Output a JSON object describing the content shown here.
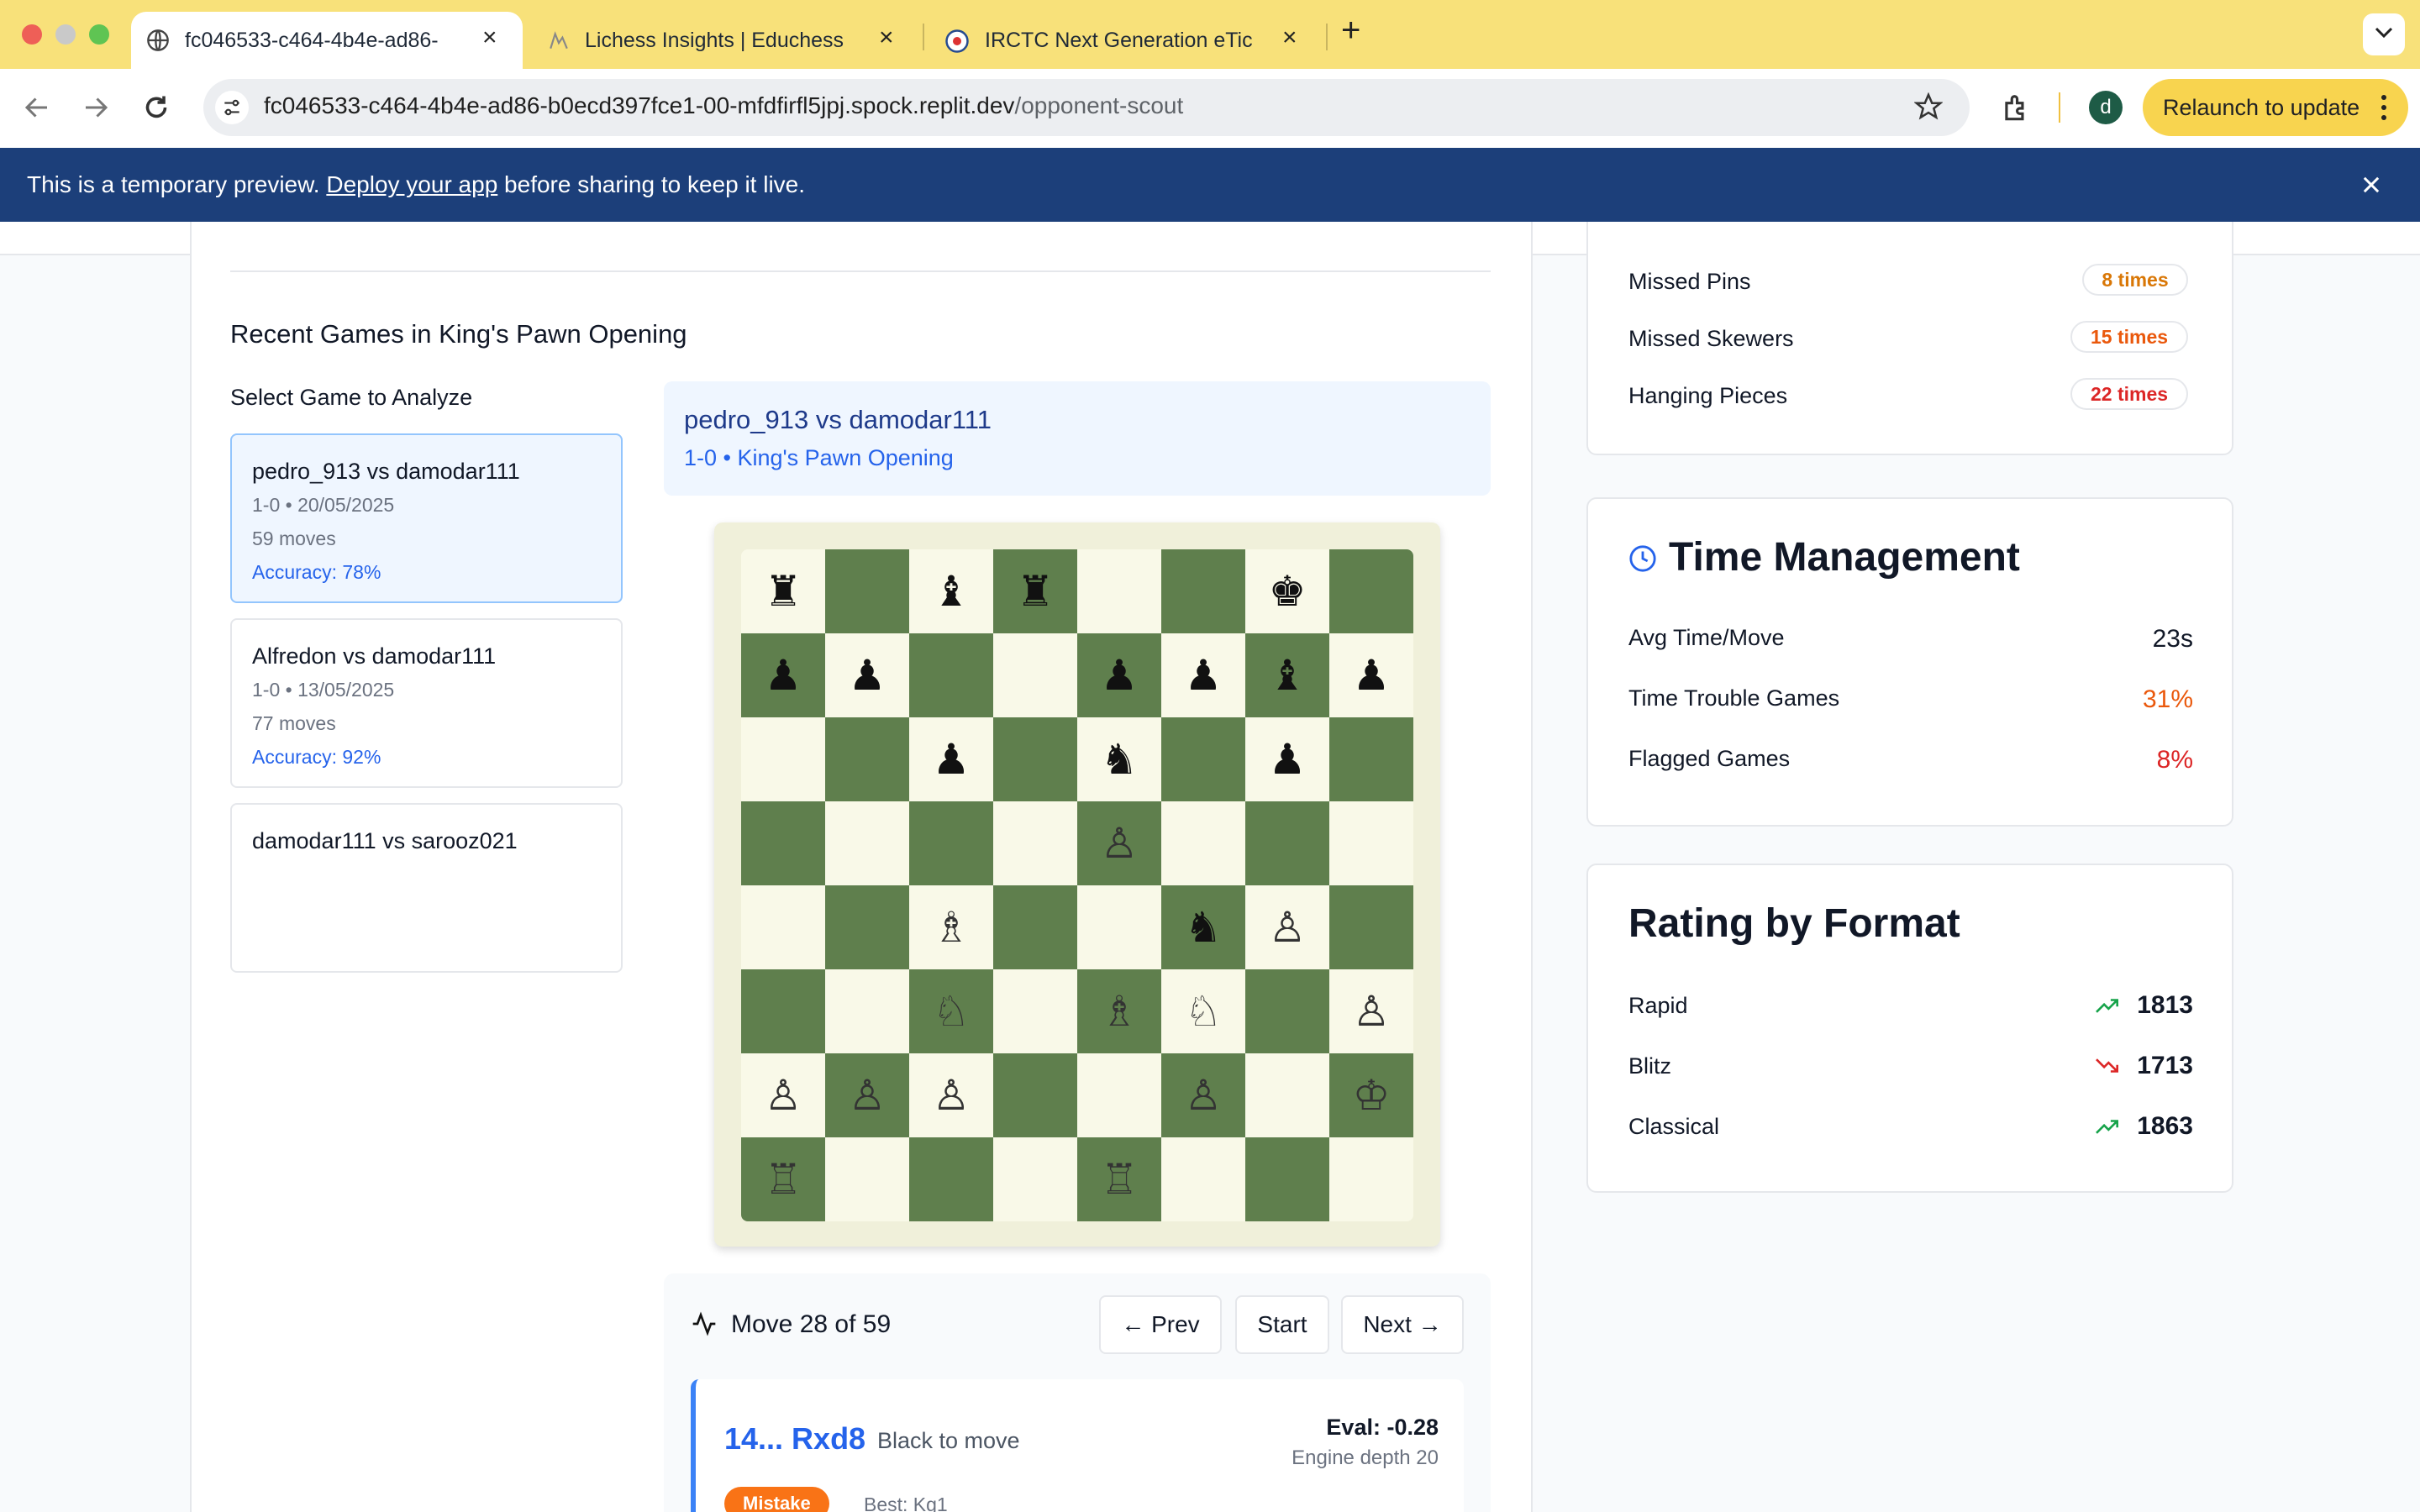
{
  "browser": {
    "tabs": [
      {
        "title": "fc046533-c464-4b4e-ad86-",
        "active": true
      },
      {
        "title": "Lichess Insights | Educhess",
        "active": false
      },
      {
        "title": "IRCTC Next Generation eTicke",
        "active": false
      }
    ],
    "url_host": "fc046533-c464-4b4e-ad86-b0ecd397fce1-00-mfdfirfl5jpj.spock.replit.dev",
    "url_path": "/opponent-scout",
    "profile_initial": "d",
    "relaunch_label": "Relaunch to update"
  },
  "banner": {
    "prefix": "This is a temporary preview.",
    "link": "Deploy your app",
    "suffix": "before sharing to keep it live."
  },
  "recent": {
    "heading": "Recent Games in King's Pawn Opening",
    "select_label": "Select Game to Analyze",
    "games": [
      {
        "title": "pedro_913 vs damodar111",
        "meta": "1-0 • 20/05/2025",
        "moves": "59 moves",
        "accuracy": "Accuracy: 78%"
      },
      {
        "title": "Alfredon vs damodar111",
        "meta": "1-0 • 13/05/2025",
        "moves": "77 moves",
        "accuracy": "Accuracy: 92%"
      },
      {
        "title": "damodar111 vs sarooz021"
      }
    ]
  },
  "selected_game": {
    "title": "pedro_913 vs damodar111",
    "subtitle": "1-0 • King's Pawn Opening"
  },
  "board": [
    [
      "r",
      "",
      "b",
      "r",
      "",
      "",
      "k",
      ""
    ],
    [
      "p",
      "p",
      "",
      "",
      "p",
      "p",
      "b",
      "p"
    ],
    [
      "",
      "",
      "p",
      "",
      "n",
      "",
      "p",
      ""
    ],
    [
      "",
      "",
      "",
      "",
      "P",
      "",
      "",
      ""
    ],
    [
      "",
      "",
      "B",
      "",
      "",
      "n",
      "P",
      ""
    ],
    [
      "",
      "",
      "N",
      "",
      "B",
      "N",
      "",
      "P"
    ],
    [
      "P",
      "P",
      "P",
      "",
      "",
      "P",
      "",
      "K"
    ],
    [
      "R",
      "",
      "",
      "",
      "R",
      "",
      "",
      ""
    ]
  ],
  "move_nav": {
    "label": "Move 28 of 59",
    "prev": "← Prev",
    "start": "Start",
    "next": "Next →"
  },
  "move_detail": {
    "move": "14... Rxd8",
    "side": "Black to move",
    "eval": "Eval: -0.28",
    "depth": "Engine depth 20",
    "tag": "Mistake",
    "best": "Best: Kg1"
  },
  "tactics": [
    {
      "label": "Missed Pins",
      "count": "8 times",
      "color": "#d97706"
    },
    {
      "label": "Missed Skewers",
      "count": "15 times",
      "color": "#ea580c"
    },
    {
      "label": "Hanging Pieces",
      "count": "22 times",
      "color": "#dc2626"
    }
  ],
  "time_management": {
    "title": "Time Management",
    "rows": [
      {
        "label": "Avg Time/Move",
        "value": "23s",
        "color": "#111827"
      },
      {
        "label": "Time Trouble Games",
        "value": "31%",
        "color": "#ea580c"
      },
      {
        "label": "Flagged Games",
        "value": "8%",
        "color": "#dc2626"
      }
    ]
  },
  "rating_by_format": {
    "title": "Rating by Format",
    "rows": [
      {
        "label": "Rapid",
        "value": "1813",
        "trend": "up"
      },
      {
        "label": "Blitz",
        "value": "1713",
        "trend": "down"
      },
      {
        "label": "Classical",
        "value": "1863",
        "trend": "up"
      }
    ]
  }
}
